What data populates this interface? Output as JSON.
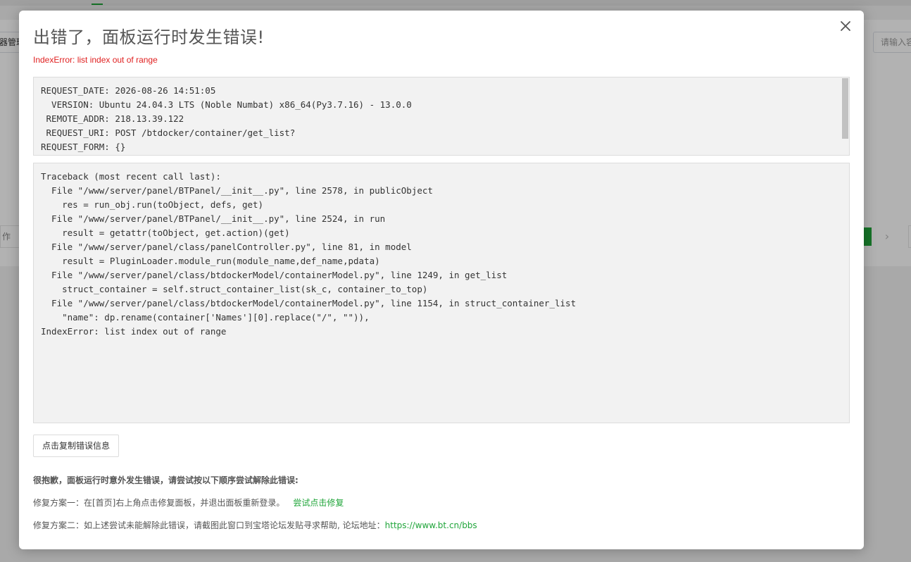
{
  "background": {
    "tab_label": "器管理",
    "search_placeholder": "请输入容器名",
    "op_label": "作",
    "pagination_next": "›"
  },
  "modal": {
    "title": "出错了，面板运行时发生错误!",
    "error_summary": "IndexError: list index out of range",
    "request_info": "REQUEST_DATE: 2026-08-26 14:51:05\n  VERSION: Ubuntu 24.04.3 LTS (Noble Numbat) x86_64(Py3.7.16) - 13.0.0\n REMOTE_ADDR: 218.13.39.122\n REQUEST_URI: POST /btdocker/container/get_list?\nREQUEST_FORM: {}",
    "traceback": "Traceback (most recent call last):\n  File \"/www/server/panel/BTPanel/__init__.py\", line 2578, in publicObject\n    res = run_obj.run(toObject, defs, get)\n  File \"/www/server/panel/BTPanel/__init__.py\", line 2524, in run\n    result = getattr(toObject, get.action)(get)\n  File \"/www/server/panel/class/panelController.py\", line 81, in model\n    result = PluginLoader.module_run(module_name,def_name,pdata)\n  File \"/www/server/panel/class/btdockerModel/containerModel.py\", line 1249, in get_list\n    struct_container = self.struct_container_list(sk_c, container_to_top)\n  File \"/www/server/panel/class/btdockerModel/containerModel.py\", line 1154, in struct_container_list\n    \"name\": dp.rename(container['Names'][0].replace(\"/\", \"\")),\nIndexError: list index out of range",
    "copy_button": "点击复制错误信息",
    "tip_heading": "很抱歉，面板运行时意外发生错误，请尝试按以下顺序尝试解除此错误:",
    "fix_one_text": "修复方案一：在[首页]右上角点击修复面板，并退出面板重新登录。",
    "fix_one_link": "尝试点击修复",
    "fix_two_text": "修复方案二：如上述尝试未能解除此错误，请截图此窗口到宝塔论坛发贴寻求帮助, 论坛地址：",
    "fix_two_link": "https://www.bt.cn/bbs",
    "close_icon": "close-icon"
  },
  "colors": {
    "accent_green": "#20a53a",
    "error_red": "#e02020"
  }
}
